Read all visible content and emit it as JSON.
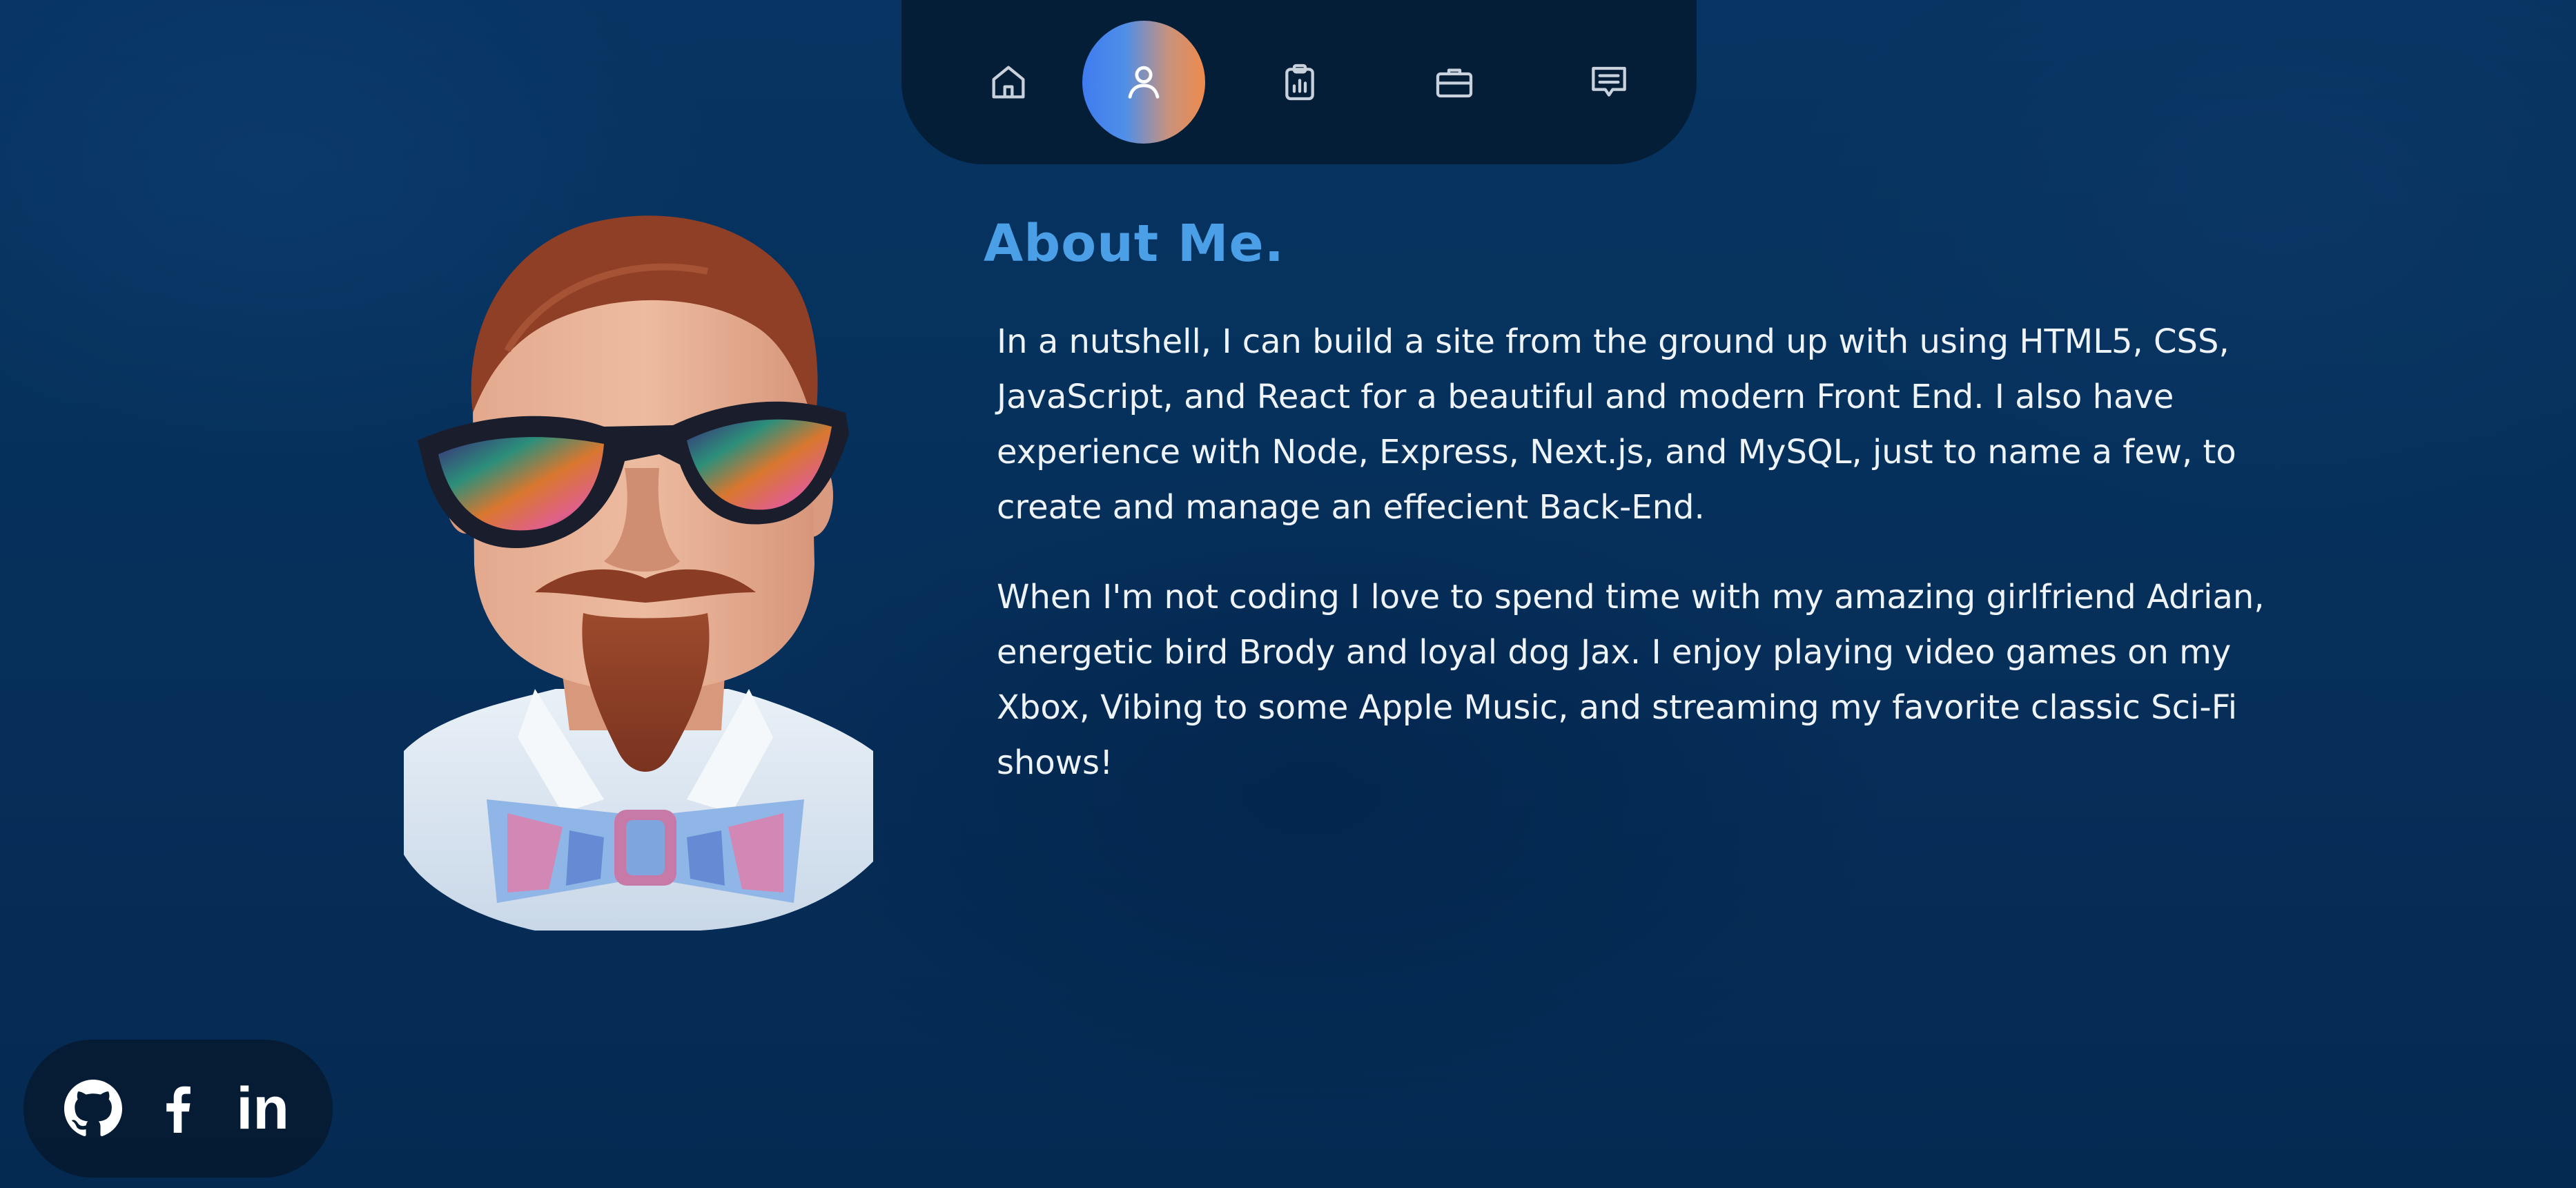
{
  "nav": {
    "items": [
      {
        "icon": "home-icon",
        "active": false
      },
      {
        "icon": "user-icon",
        "active": true
      },
      {
        "icon": "clipboard-chart-icon",
        "active": false
      },
      {
        "icon": "briefcase-icon",
        "active": false
      },
      {
        "icon": "chat-icon",
        "active": false
      }
    ],
    "active_gradient": [
      "#3f7cf0",
      "#ee8a4c"
    ]
  },
  "about": {
    "title": "About Me.",
    "paragraph1": "In a nutshell, I can build a site from the ground up with using HTML5, CSS, JavaScript, and React for a beautiful and modern Front End. I also have experience with Node, Express, Next.js, and MySQL, just to name a few, to create and manage an effecient Back-End.",
    "paragraph2": "When I'm not coding I love to spend time with my amazing girlfriend Adrian, energetic bird Brody and loyal dog Jax. I enjoy playing video games on my Xbox, Vibing to some Apple Music, and streaming my favorite classic Sci-Fi shows!"
  },
  "avatar": {
    "icon": "profile-photo"
  },
  "social": {
    "links": [
      {
        "icon": "github-icon"
      },
      {
        "icon": "facebook-icon"
      },
      {
        "icon": "linkedin-icon",
        "label": "in"
      }
    ]
  },
  "colors": {
    "background": "#06305b",
    "title": "#4a9fe6",
    "text": "#eef3f8",
    "panel": "#061628"
  }
}
